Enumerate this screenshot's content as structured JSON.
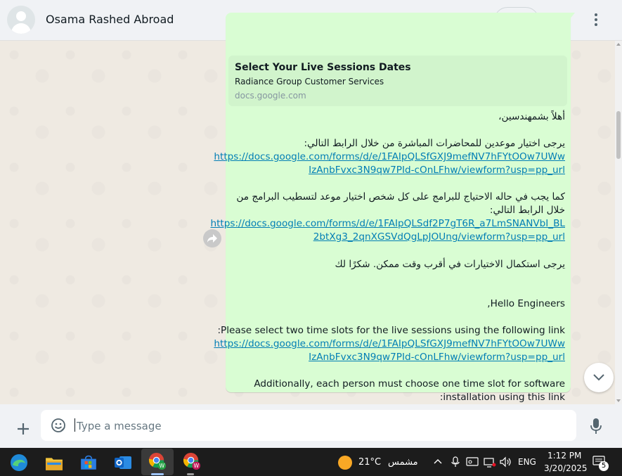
{
  "header": {
    "contact_name": "Osama Rashed Abroad",
    "icons": [
      "video-camera-icon",
      "chevron-down-icon",
      "search-icon",
      "menu-dots-icon"
    ]
  },
  "message": {
    "preview": {
      "title": "Select Your Live Sessions Dates",
      "description": "Radiance Group Customer Services",
      "domain": "docs.google.com"
    },
    "lines": [
      "أهلاً بشمهندسين،",
      "يرجى اختيار موعدين للمحاضرات المباشرة من خلال الرابط التالي:",
      "https://docs.google.com/forms/d/e/1FAIpQLSfGXJ9mefNV7hFYtOOw7UWw",
      "IzAnbFvxc3N9qw7PId-cOnLFhw/viewform?usp=pp_url",
      "كما يجب في حاله الاحتياج للبرامج على كل شخص اختيار موعد لتسطيب البرامج من",
      "خلال الرابط التالي:",
      "https://docs.google.com/forms/d/e/1FAIpQLSdf2P7gT6R_a7LmSNANVbI_BL",
      "2btXg3_2qnXGSVdQgLpJOUng/viewform?usp=pp_url",
      "يرجى استكمال الاختيارات في أقرب وقت ممكن. شكرًا لك",
      "Hello Engineers,",
      "Please select two time slots for the live sessions using the following link:",
      "https://docs.google.com/forms/d/e/1FAIpQLSfGXJ9mefNV7hFYtOOw7UWw",
      "IzAnbFvxc3N9qw7PId-cOnLFhw/viewform?usp=pp_url",
      "Additionally, each person must choose one time slot for software",
      "installation using this link:"
    ]
  },
  "composer": {
    "placeholder": "Type a message",
    "icons": [
      "plus-icon",
      "sticker-icon",
      "microphone-icon"
    ]
  },
  "taskbar": {
    "apps": [
      "edge-icon",
      "file-explorer-icon",
      "microsoft-store-icon",
      "outlook-icon",
      "chrome-whatsapp-icon",
      "chrome-whatsapp-icon"
    ],
    "weather_temp": "21°C",
    "weather_text": "مشمس",
    "language": "ENG",
    "time": "1:12 PM",
    "date": "3/20/2025",
    "notification_count": "5"
  }
}
